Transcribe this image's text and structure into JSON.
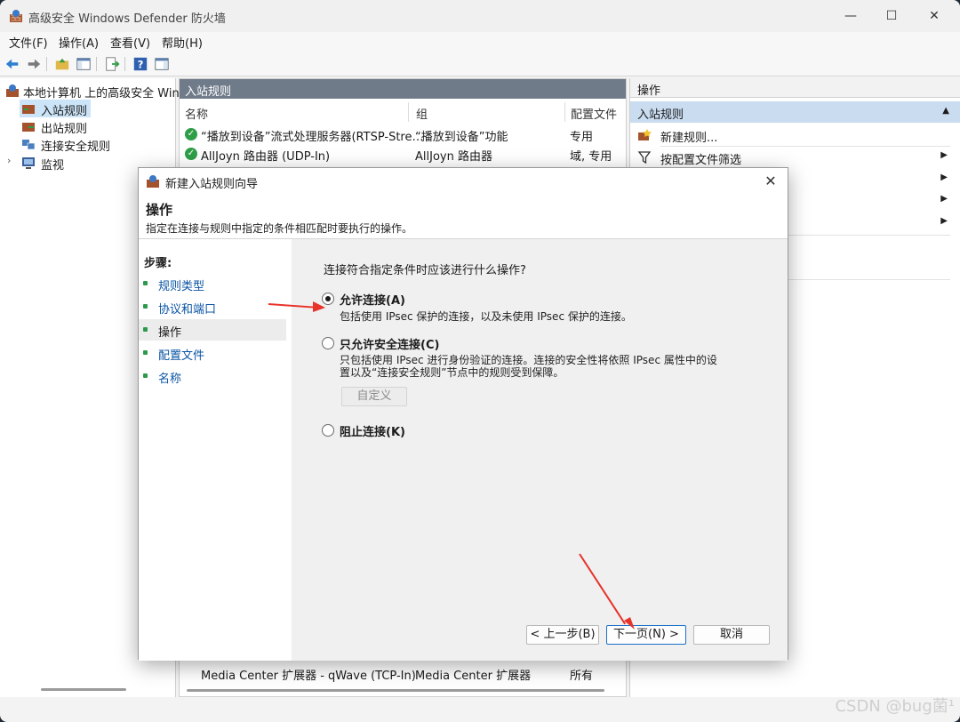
{
  "window": {
    "title": "高级安全 Windows Defender 防火墙"
  },
  "menu": [
    "文件(F)",
    "操作(A)",
    "查看(V)",
    "帮助(H)"
  ],
  "tree": {
    "root": "本地计算机 上的高级安全 Windows",
    "items": [
      "入站规则",
      "出站规则",
      "连接安全规则",
      "监视"
    ]
  },
  "middle": {
    "header": "入站规则",
    "columns": [
      "名称",
      "组",
      "配置文件"
    ],
    "rows": [
      {
        "name": "“播放到设备”流式处理服务器(RTSP-Stre…",
        "group": "“播放到设备”功能",
        "profile": "专用"
      },
      {
        "name": "AllJoyn 路由器 (UDP-In)",
        "group": "AllJoyn 路由器",
        "profile": "域, 专用"
      }
    ],
    "bottom_row": {
      "name": "Media Center 扩展器 - qWave (TCP-In)",
      "group": "Media Center 扩展器",
      "profile": "所有"
    }
  },
  "actions": {
    "header": "操作",
    "section": "入站规则",
    "items": [
      "新建规则...",
      "按配置文件筛选"
    ]
  },
  "dialog": {
    "title": "新建入站规则向导",
    "heading": "操作",
    "subheading": "指定在连接与规则中指定的条件相匹配时要执行的操作。",
    "steps_caption": "步骤:",
    "steps": [
      "规则类型",
      "协议和端口",
      "操作",
      "配置文件",
      "名称"
    ],
    "question": "连接符合指定条件时应该进行什么操作?",
    "options": [
      {
        "label": "允许连接(A)",
        "desc": "包括使用 IPsec 保护的连接，以及未使用 IPsec 保护的连接。",
        "selected": true
      },
      {
        "label": "只允许安全连接(C)",
        "desc1": "只包括使用 IPsec 进行身份验证的连接。连接的安全性将依照 IPsec 属性中的设",
        "desc2": "置以及“连接安全规则”节点中的规则受到保障。",
        "selected": false
      },
      {
        "label": "阻止连接(K)",
        "selected": false
      }
    ],
    "customize": "自定义",
    "back": "< 上一步(B)",
    "next": "下一页(N) >",
    "cancel": "取消"
  },
  "watermark": "CSDN @bug菌¹"
}
